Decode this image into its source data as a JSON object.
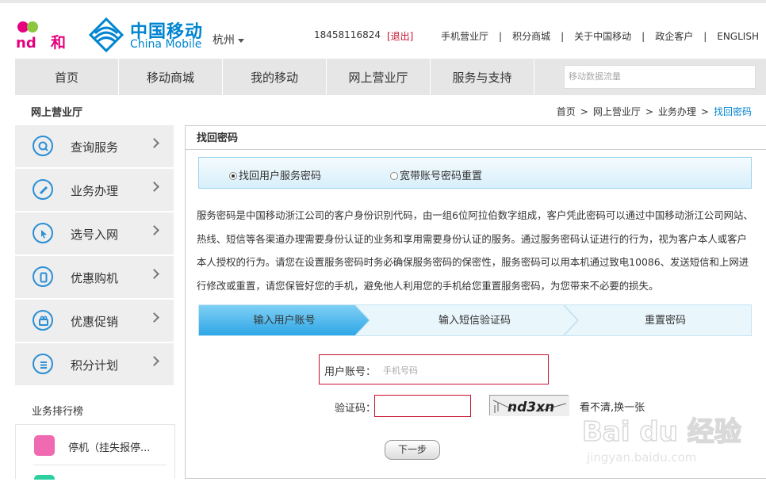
{
  "header": {
    "and_logo": "和",
    "brand_cn": "中国移动",
    "brand_en": "China Mobile",
    "city": "杭州",
    "phone": "18458116824",
    "logout": "[退出]",
    "links": [
      "手机营业厅",
      "积分商城",
      "关于中国移动",
      "政企客户",
      "ENGLISH"
    ]
  },
  "nav": {
    "items": [
      "首页",
      "移动商城",
      "我的移动",
      "网上营业厅",
      "服务与支持"
    ],
    "search_placeholder": "移动数据流量"
  },
  "sidebar": {
    "title": "网上营业厅",
    "items": [
      {
        "label": "查询服务",
        "icon": "search-icon"
      },
      {
        "label": "业务办理",
        "icon": "pencil-icon"
      },
      {
        "label": "选号入网",
        "icon": "cursor-icon"
      },
      {
        "label": "优惠购机",
        "icon": "phone-icon"
      },
      {
        "label": "优惠促销",
        "icon": "gift-icon"
      },
      {
        "label": "积分计划",
        "icon": "list-icon"
      }
    ],
    "rank_title": "业务排行榜",
    "rank_items": [
      {
        "label": "停机（挂失报停...",
        "icon": "smile-icon"
      }
    ]
  },
  "breadcrumb": {
    "items": [
      "首页",
      "网上营业厅",
      "业务办理"
    ],
    "current": "找回密码",
    "sep": ">"
  },
  "main": {
    "title": "找回密码",
    "radios": [
      {
        "label": "找回用户服务密码",
        "checked": true
      },
      {
        "label": "宽带账号密码重置",
        "checked": false
      }
    ],
    "description": "服务密码是中国移动浙江公司的客户身份识别代码，由一组6位阿拉伯数字组成，客户凭此密码可以通过中国移动浙江公司网站、热线、短信等各渠道办理需要身份认证的业务和享用需要身份认证的服务。通过服务密码认证进行的行为，视为客户本人或客户本人授权的行为。请您在设置服务密码时务必确保服务密码的保密性，服务密码可以用本机通过致电10086、发送短信和上网进行修改或重置，请您保管好您的手机，避免他人利用您的手机给您重置服务密码，为您带来不必要的损失。",
    "steps": [
      "输入用户账号",
      "输入短信验证码",
      "重置密码"
    ],
    "active_step": 1,
    "form": {
      "account_label": "用户账号：",
      "account_placeholder": "手机号码",
      "code_label": "验证码：",
      "code_value": "",
      "captcha_text": "nd3xn",
      "refresh_label": "看不清,换一张",
      "next_label": "下一步"
    }
  },
  "watermark": {
    "text": "Bai du 经验",
    "url_text": "jingyan.baidu.com"
  },
  "colors": {
    "brand_blue": "#0085d0",
    "accent_red": "#c8102e",
    "and_pink": "#e6007e",
    "and_green": "#8cc63f",
    "step_active": "#3aaee8"
  }
}
